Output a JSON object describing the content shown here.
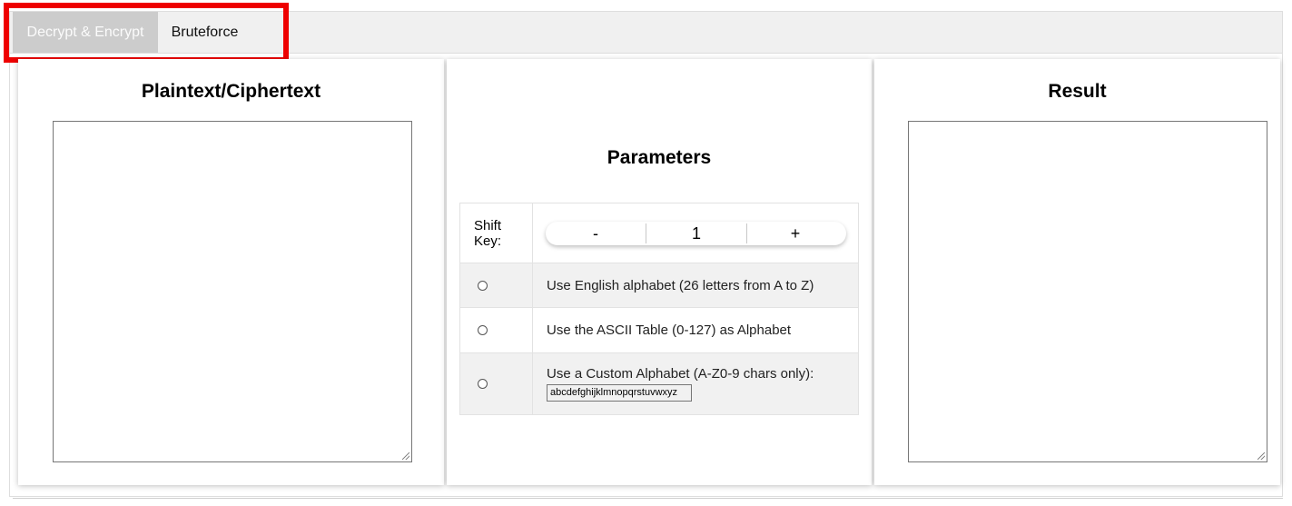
{
  "tabs": [
    {
      "label": "Decrypt & Encrypt",
      "active": true
    },
    {
      "label": "Bruteforce",
      "active": false
    }
  ],
  "highlight_color": "#ee0000",
  "input_panel": {
    "title": "Plaintext/Ciphertext",
    "value": ""
  },
  "parameters": {
    "title": "Parameters",
    "shift_key": {
      "label": "Shift Key:",
      "decrement": "-",
      "value": "1",
      "increment": "+"
    },
    "options": [
      {
        "label": "Use English alphabet (26 letters from A to Z)",
        "selected": false
      },
      {
        "label": "Use the ASCII Table (0-127) as Alphabet",
        "selected": false
      },
      {
        "label": "Use a Custom Alphabet (A-Z0-9 chars only):",
        "selected": false,
        "input_value": "abcdefghijklmnopqrstuvwxyz"
      }
    ]
  },
  "result_panel": {
    "title": "Result",
    "value": ""
  }
}
